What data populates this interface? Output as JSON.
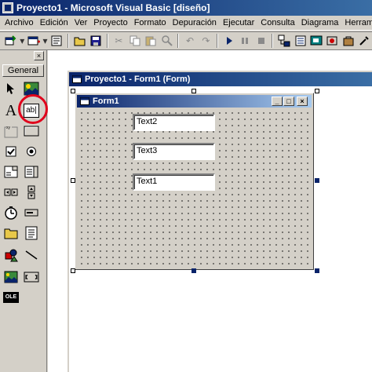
{
  "window": {
    "title": "Proyecto1 - Microsoft Visual Basic [diseño]"
  },
  "menu": [
    "Archivo",
    "Edición",
    "Ver",
    "Proyecto",
    "Formato",
    "Depuración",
    "Ejecutar",
    "Consulta",
    "Diagrama",
    "Herramient"
  ],
  "toolbar": {
    "items": [
      "add-project-icon",
      "add-form-icon",
      "menu-editor-icon",
      "open-icon",
      "save-icon",
      "cut-icon",
      "copy-icon",
      "paste-icon",
      "find-icon",
      "undo-icon",
      "redo-icon",
      "run-icon",
      "pause-icon",
      "stop-icon",
      "project-explorer-icon",
      "properties-icon",
      "form-layout-icon",
      "object-browser-icon",
      "toolbox-icon",
      "tools-icon"
    ]
  },
  "toolbox": {
    "close": "×",
    "tab": "General",
    "tools": [
      "pointer-icon",
      "picturebox-icon",
      "label-icon",
      "textbox-icon",
      "frame-icon",
      "commandbutton-icon",
      "checkbox-icon",
      "optionbutton-icon",
      "combobox-icon",
      "listbox-icon",
      "hscrollbar-icon",
      "vscrollbar-icon",
      "timer-icon",
      "drivelistbox-icon",
      "dirlistbox-icon",
      "filelistbox-icon",
      "shape-icon",
      "line-icon",
      "image-icon",
      "data-icon",
      "ole-icon"
    ],
    "label_glyph": "A",
    "textbox_glyph": "ab|",
    "ole_glyph": "OLE",
    "highlight_color": "#e0001b"
  },
  "project_window": {
    "title": "Proyecto1 - Form1 (Form)"
  },
  "form": {
    "title": "Form1",
    "textboxes": [
      "Text2",
      "Text3",
      "Text1"
    ],
    "min_glyph": "_",
    "max_glyph": "□",
    "close_glyph": "×"
  },
  "colors": {
    "titlebar_start": "#0a246a",
    "titlebar_end": "#3a6ea5",
    "face": "#d4d0c8"
  }
}
